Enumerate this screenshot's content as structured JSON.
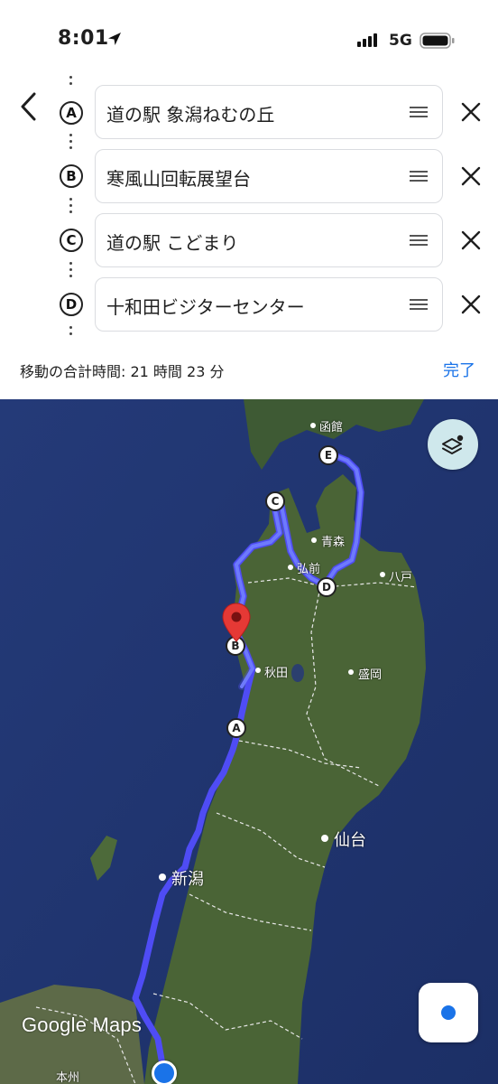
{
  "status": {
    "time": "8:01",
    "network": "5G"
  },
  "waypoints": [
    {
      "letter": "A",
      "name": "道の駅 象潟ねむの丘"
    },
    {
      "letter": "B",
      "name": "寒風山回転展望台"
    },
    {
      "letter": "C",
      "name": "道の駅 こどまり"
    },
    {
      "letter": "D",
      "name": "十和田ビジターセンター"
    }
  ],
  "total_travel_time": "移動の合計時間: 21 時間 23 分",
  "done_label": "完了",
  "map": {
    "logo_text": "Google Maps",
    "route_color": "#4f4cf5",
    "route_light_color": "#7f93ff",
    "pin_color": "#e53935",
    "my_location_color": "#1a73e8",
    "city_labels": [
      "函館",
      "青森",
      "弘前",
      "八戸",
      "秋田",
      "盛岡",
      "仙台",
      "新潟",
      "本州"
    ],
    "markers": [
      "A",
      "B",
      "C",
      "D",
      "E"
    ],
    "icons": [
      "layers-icon",
      "my-location-icon",
      "location-pin-icon"
    ]
  }
}
